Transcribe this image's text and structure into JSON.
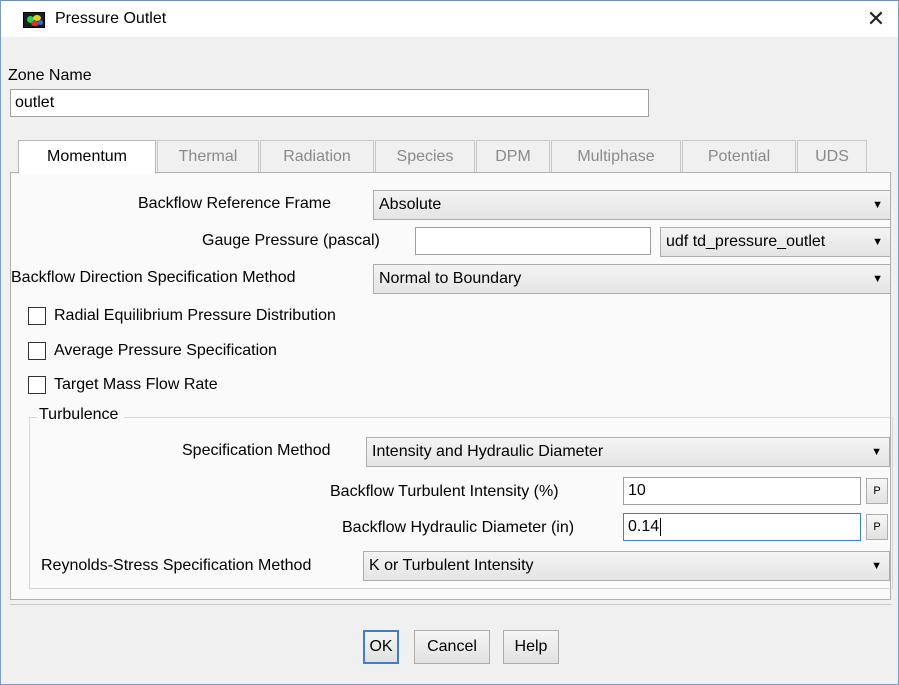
{
  "window": {
    "title": "Pressure Outlet",
    "close_glyph": "✕"
  },
  "zone": {
    "label": "Zone Name",
    "value": "outlet"
  },
  "tabs": [
    {
      "label": "Momentum",
      "active": true
    },
    {
      "label": "Thermal",
      "active": false
    },
    {
      "label": "Radiation",
      "active": false
    },
    {
      "label": "Species",
      "active": false
    },
    {
      "label": "DPM",
      "active": false
    },
    {
      "label": "Multiphase",
      "active": false
    },
    {
      "label": "Potential",
      "active": false
    },
    {
      "label": "UDS",
      "active": false
    }
  ],
  "momentum": {
    "backflow_frame": {
      "label": "Backflow Reference Frame",
      "value": "Absolute"
    },
    "gauge_pressure": {
      "label": "Gauge Pressure (pascal)",
      "value": "",
      "profile": "udf td_pressure_outlet"
    },
    "backflow_direction": {
      "label": "Backflow Direction Specification Method",
      "value": "Normal to Boundary"
    },
    "checkboxes": [
      {
        "label": "Radial Equilibrium Pressure Distribution",
        "checked": false
      },
      {
        "label": "Average Pressure Specification",
        "checked": false
      },
      {
        "label": "Target Mass Flow Rate",
        "checked": false
      }
    ],
    "turbulence": {
      "title": "Turbulence",
      "spec_method": {
        "label": "Specification Method",
        "value": "Intensity and Hydraulic Diameter"
      },
      "intensity": {
        "label": "Backflow Turbulent Intensity (%)",
        "value": "10",
        "p_label": "P"
      },
      "diameter": {
        "label": "Backflow Hydraulic Diameter (in)",
        "value": "0.14",
        "p_label": "P"
      }
    },
    "reynolds": {
      "label": "Reynolds-Stress Specification Method",
      "value": "K or Turbulent Intensity"
    }
  },
  "buttons": {
    "ok": "OK",
    "cancel": "Cancel",
    "help": "Help"
  },
  "icons": {
    "app": "ansys-fluent-icon",
    "dropdown": "▼"
  }
}
